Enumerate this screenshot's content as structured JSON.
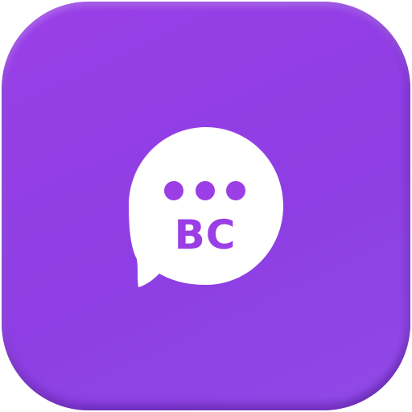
{
  "icon": {
    "monogram": "BC",
    "glyph_name": "chat-bubble-icon",
    "colors": {
      "background_start": "#9a3fe8",
      "background_end": "#9049e6",
      "bubble": "#ffffff",
      "accent": "#9b3ee6"
    }
  }
}
